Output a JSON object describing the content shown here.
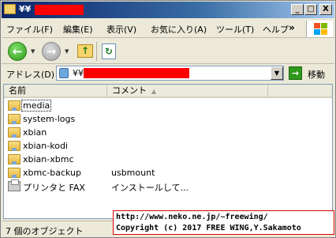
{
  "window": {
    "title": "¥¥",
    "controls": {
      "minimize": "_",
      "maximize": "□",
      "close": "X"
    }
  },
  "menubar": {
    "items": [
      "ファイル(F)",
      "編集(E)",
      "表示(V)",
      "お気に入り(A)",
      "ツール(T)",
      "ヘルプ"
    ],
    "more": "»"
  },
  "toolbar": {
    "back": "←",
    "forward": "→",
    "up": "↑",
    "sync": "↻"
  },
  "addressbar": {
    "label": "アドレス(D)",
    "value": "¥¥",
    "go_label": "移動",
    "go_arrow": "→",
    "dropdown": "▼"
  },
  "listview": {
    "columns": [
      "名前",
      "コメント"
    ],
    "sort_indicator": "▲",
    "rows": [
      {
        "name": "media",
        "comment": "",
        "icon": "folder-share-icon",
        "selected": true
      },
      {
        "name": "system-logs",
        "comment": "",
        "icon": "folder-share-icon"
      },
      {
        "name": "xbian",
        "comment": "",
        "icon": "folder-share-icon"
      },
      {
        "name": "xbian-kodi",
        "comment": "",
        "icon": "folder-share-icon"
      },
      {
        "name": "xbian-xbmc",
        "comment": "",
        "icon": "folder-share-icon"
      },
      {
        "name": "xbmc-backup",
        "comment": "usbmount",
        "icon": "folder-share-icon"
      },
      {
        "name": "プリンタと FAX",
        "comment": "インストールして...",
        "icon": "printer-icon"
      }
    ]
  },
  "statusbar": {
    "text": "7 個のオブジェクト"
  },
  "credit": {
    "line1": "http://www.neko.ne.jp/~freewing/",
    "line2": "Copyright (c) 2017 FREE WING,Y.Sakamoto"
  },
  "colors": {
    "redaction": "#ff0000",
    "title_gradient_start": "#0a246a",
    "credit_border": "#e00000"
  }
}
